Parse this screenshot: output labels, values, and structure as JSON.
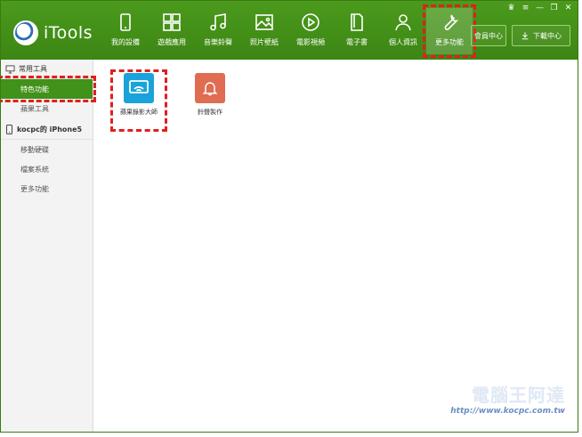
{
  "app": {
    "name": "iTools"
  },
  "nav": [
    {
      "id": "devices",
      "label": "我的設備"
    },
    {
      "id": "games",
      "label": "遊戲應用"
    },
    {
      "id": "ringtones",
      "label": "音樂鈴聲"
    },
    {
      "id": "wallpapers",
      "label": "照片壁紙"
    },
    {
      "id": "videos",
      "label": "電影視頻"
    },
    {
      "id": "ebooks",
      "label": "電子書"
    },
    {
      "id": "personal",
      "label": "個人資訊"
    },
    {
      "id": "more",
      "label": "更多功能"
    }
  ],
  "top_buttons": {
    "member": "會員中心",
    "download": "下載中心"
  },
  "sidebar": {
    "section1": "常用工具",
    "items1": [
      "特色功能",
      "蘋果工具"
    ],
    "device": "kocpc的 iPhone5",
    "items2": [
      "移動硬碟",
      "檔案系統",
      "更多功能"
    ]
  },
  "apps": [
    {
      "label": "蘋果錄影大師"
    },
    {
      "label": "鈴聲製作"
    }
  ],
  "watermark": {
    "title": "電腦王阿達",
    "url": "http://www.kocpc.com.tw"
  },
  "colors": {
    "green": "#3c8614",
    "active": "#41921a",
    "highlight": "#e0201c",
    "app1": "#1aa3db",
    "app2": "#e06c52"
  }
}
